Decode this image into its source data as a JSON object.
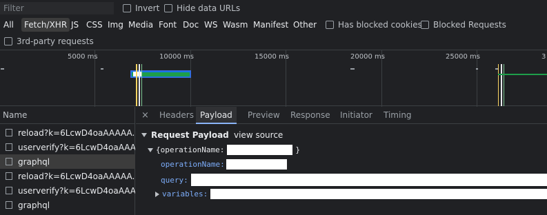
{
  "filter": {
    "placeholder": "Filter",
    "value": ""
  },
  "options": {
    "invert": "Invert",
    "hide_data_urls": "Hide data URLs",
    "has_blocked_cookies": "Has blocked cookies",
    "blocked_requests": "Blocked Requests",
    "third_party": "3rd-party requests"
  },
  "types": [
    "All",
    "Fetch/XHR",
    "JS",
    "CSS",
    "Img",
    "Media",
    "Font",
    "Doc",
    "WS",
    "Wasm",
    "Manifest",
    "Other"
  ],
  "active_type": "Fetch/XHR",
  "timeline": {
    "ticks": [
      "5000 ms",
      "10000 ms",
      "15000 ms",
      "20000 ms",
      "25000 ms",
      "3"
    ]
  },
  "requests": {
    "header": "Name",
    "items": [
      "reload?k=6LcwD4oaAAAAA...",
      "userverify?k=6LcwD4oaAAA...",
      "graphql",
      "reload?k=6LcwD4oaAAAAA...",
      "userverify?k=6LcwD4oaAAA...",
      "graphql"
    ],
    "selected_index": 2
  },
  "detail": {
    "close": "×",
    "tabs": [
      "Headers",
      "Payload",
      "Preview",
      "Response",
      "Initiator",
      "Timing"
    ],
    "active_tab": "Payload"
  },
  "payload": {
    "section_title": "Request Payload",
    "view_source": "view source",
    "root_open": "{operationName:",
    "root_close": "}",
    "fields": {
      "operationName": "operationName:",
      "query": "query:",
      "variables": "variables:"
    }
  },
  "colors": {
    "accent": "#8ab4f8",
    "bar_green": "#1e9e4a",
    "key_blue": "#7cacf8"
  }
}
